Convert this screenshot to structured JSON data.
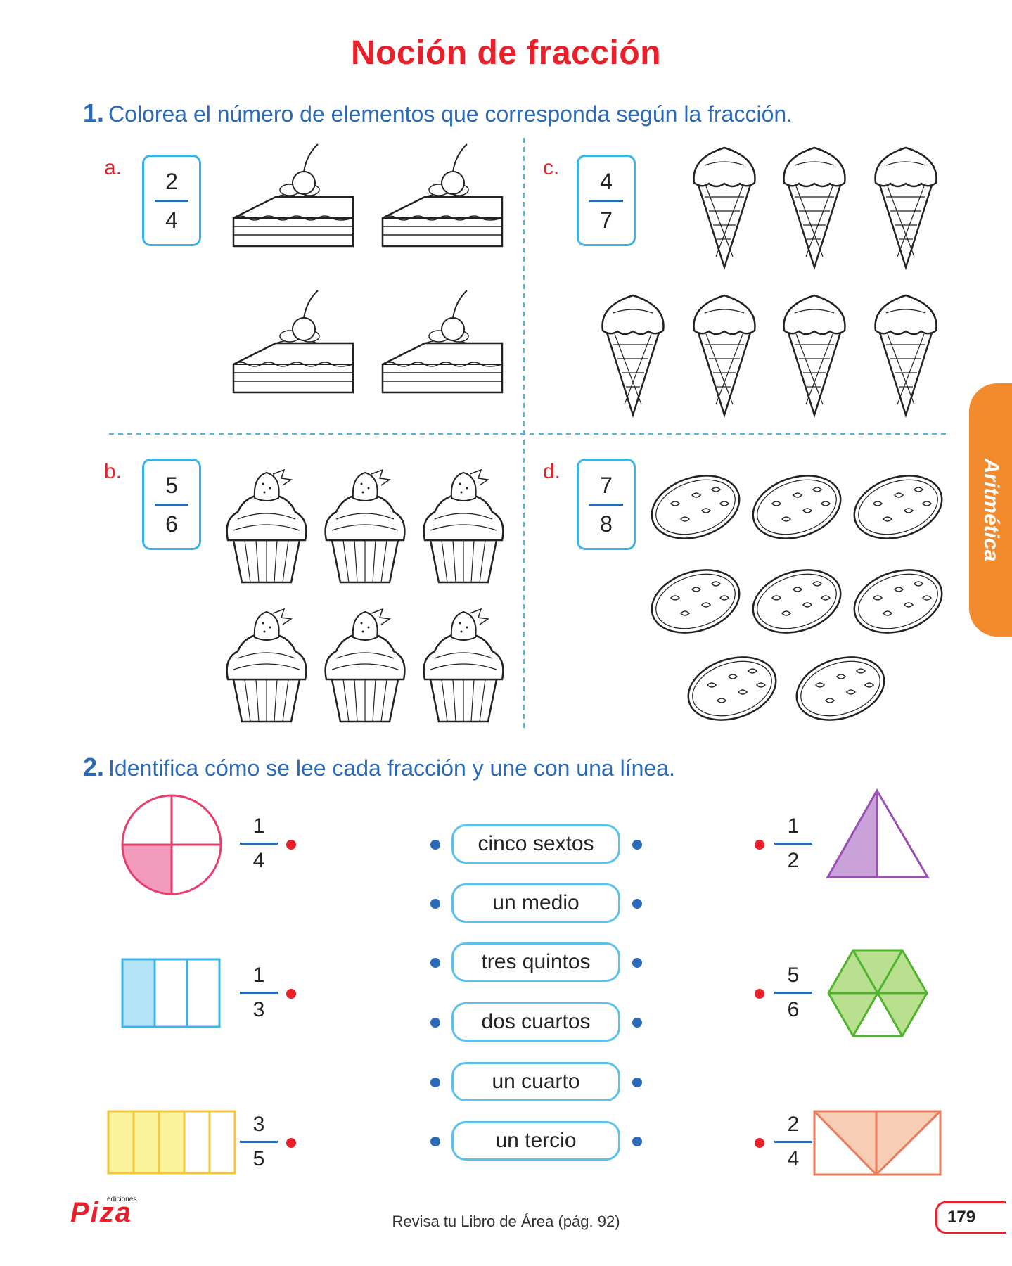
{
  "title": "Noción de fracción",
  "ex1": {
    "number": "1.",
    "instruction": "Colorea el número de elementos que corresponda según la fracción.",
    "items": [
      {
        "letter": "a.",
        "numerator": "2",
        "denominator": "4",
        "item": "cake-slice",
        "count": 4
      },
      {
        "letter": "b.",
        "numerator": "5",
        "denominator": "6",
        "item": "cupcake",
        "count": 6
      },
      {
        "letter": "c.",
        "numerator": "4",
        "denominator": "7",
        "item": "ice-cream-cone",
        "count": 7
      },
      {
        "letter": "d.",
        "numerator": "7",
        "denominator": "8",
        "item": "cookie",
        "count": 8
      }
    ]
  },
  "ex2": {
    "number": "2.",
    "instruction": "Identifica cómo se lee cada fracción y une con una línea.",
    "left": [
      {
        "numerator": "1",
        "denominator": "4",
        "shape": "circle",
        "color": "#f29bbd"
      },
      {
        "numerator": "1",
        "denominator": "3",
        "shape": "rectangle",
        "color": "#b3e3f7"
      },
      {
        "numerator": "3",
        "denominator": "5",
        "shape": "rectangle",
        "color": "#fbf29c"
      }
    ],
    "words": [
      "cinco sextos",
      "un medio",
      "tres quintos",
      "dos cuartos",
      "un cuarto",
      "un tercio"
    ],
    "right": [
      {
        "numerator": "1",
        "denominator": "2",
        "shape": "triangle",
        "color": "#c8a2d8"
      },
      {
        "numerator": "5",
        "denominator": "6",
        "shape": "hexagon",
        "color": "#b9e08e"
      },
      {
        "numerator": "2",
        "denominator": "4",
        "shape": "rectangle",
        "color": "#f8cdb6"
      }
    ]
  },
  "side_tab": "Aritmética",
  "footer": {
    "reference": "Revisa tu Libro de Área (pág. 92)",
    "page_number": "179",
    "brand": "Piza",
    "brand_sub": "ediciones"
  },
  "colors": {
    "title_red": "#e8202a",
    "instruction_blue": "#2a6ab8",
    "box_cyan": "#3bb5e8",
    "tab_orange": "#f28a2e"
  }
}
